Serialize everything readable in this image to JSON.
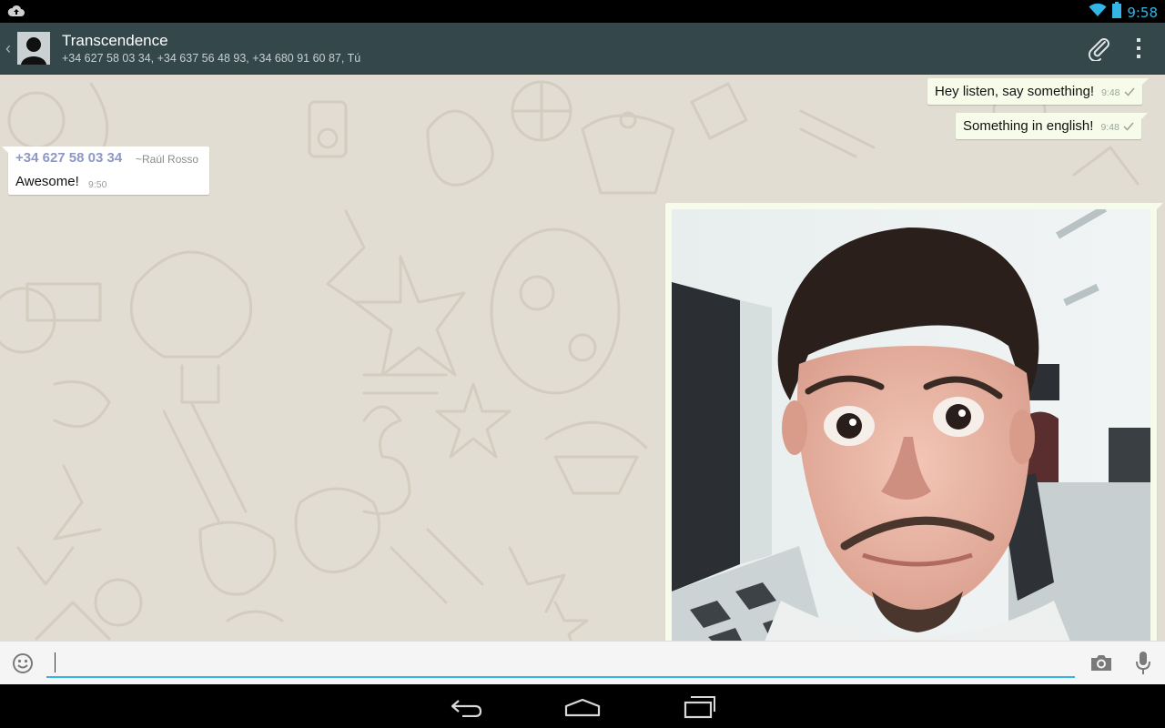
{
  "status_bar": {
    "time": "9:58",
    "icons": [
      "cloud-upload-icon",
      "wifi-icon",
      "battery-icon"
    ]
  },
  "action_bar": {
    "back_icon": "chevron-left-icon",
    "title": "Transcendence",
    "subtitle": "+34 627 58 03 34, +34 637 56 48 93, +34 680 91 60 87, Tú",
    "actions": [
      "paperclip-icon",
      "overflow-menu-icon"
    ]
  },
  "messages": {
    "out_1": {
      "text": "Hey listen, say something!",
      "time": "9:48"
    },
    "out_2": {
      "text": "Something in english!",
      "time": "9:48"
    },
    "in_1": {
      "sender_phone": "+34 627 58 03 34",
      "sender_name": "~Raúl Rosso",
      "text": "Awesome!",
      "time": "9:50"
    },
    "image_message": {
      "type": "photo"
    }
  },
  "input_bar": {
    "message_value": "",
    "icons": [
      "smiley-icon",
      "camera-icon",
      "microphone-icon"
    ]
  },
  "nav_bar": {
    "buttons": [
      "back-nav-icon",
      "home-nav-icon",
      "recents-nav-icon"
    ]
  },
  "colors": {
    "action_bar": "#34474b",
    "chat_background": "#e2ddd2",
    "outgoing_bubble": "#f7fbe9",
    "accent": "#33b5e5",
    "sender_name": "#8e97c6"
  }
}
